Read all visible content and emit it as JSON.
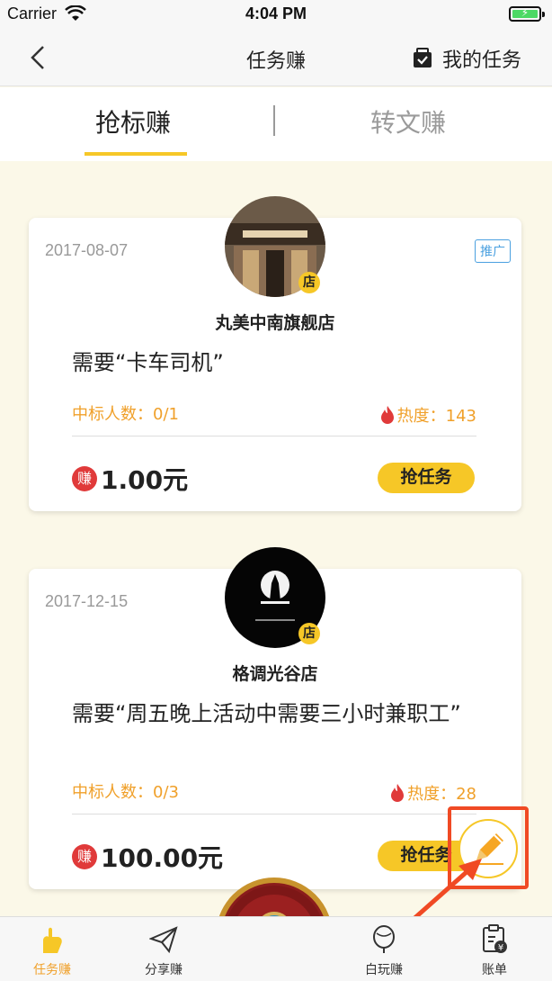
{
  "status_bar": {
    "carrier": "Carrier",
    "time": "4:04 PM"
  },
  "nav": {
    "title": "任务赚",
    "my_tasks": "我的任务"
  },
  "tabs": [
    {
      "label": "抢标赚"
    },
    {
      "label": "转文赚"
    }
  ],
  "cards": [
    {
      "date": "2017-08-07",
      "promo": "推广",
      "badge": "店",
      "shop": "丸美中南旗舰店",
      "need": "需要“卡车司机”",
      "winners": "中标人数：0/1",
      "heat": "热度：143",
      "earn_icon": "赚",
      "reward": "1.00元",
      "button": "抢任务"
    },
    {
      "date": "2017-12-15",
      "badge": "店",
      "shop": "格调光谷店",
      "need": "需要“周五晚上活动中需要三小时兼职工”",
      "winners": "中标人数：0/3",
      "heat": "热度：28",
      "earn_icon": "赚",
      "reward": "100.00元",
      "button": "抢任务"
    }
  ],
  "tabbar": [
    {
      "label": "任务赚",
      "icon": "hand-icon"
    },
    {
      "label": "分享赚",
      "icon": "paper-plane-icon"
    },
    {
      "label": "",
      "icon": "go-wheel-icon"
    },
    {
      "label": "白玩赚",
      "icon": "balloon-icon"
    },
    {
      "label": "账单",
      "icon": "bill-icon"
    }
  ],
  "colors": {
    "accent": "#f6c727",
    "orange_text": "#f0a02a",
    "highlight": "#f04a24",
    "earn_red": "#e03a3a"
  }
}
